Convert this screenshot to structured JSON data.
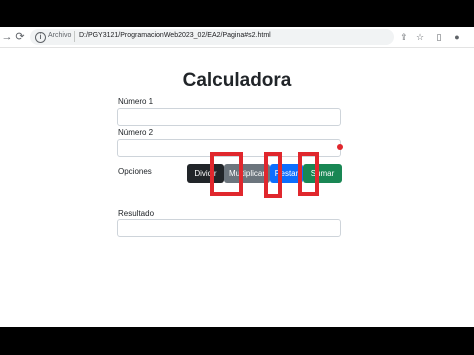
{
  "browser": {
    "scheme_label": "Archivo",
    "url": "D:/PGY3121/ProgramacionWeb2023_02/EA2/Pagina#s2.html",
    "icons": [
      "back-arrow-icon",
      "reload-icon",
      "info-icon",
      "share-icon",
      "star-icon",
      "sidebar-icon",
      "profile-icon"
    ]
  },
  "page": {
    "title": "Calculadora",
    "fields": {
      "numero1": {
        "label": "Número 1",
        "value": ""
      },
      "numero2": {
        "label": "Número 2",
        "value": ""
      },
      "opciones": {
        "label": "Opciones"
      },
      "resultado": {
        "label": "Resultado",
        "value": ""
      }
    },
    "buttons": {
      "dividir": "Dividir",
      "multiplicar": "Multiplicar",
      "restar": "Restar",
      "sumar": "Sumar"
    }
  },
  "colors": {
    "dividir": "#212529",
    "multiplicar": "#6c757d",
    "restar": "#0d6efd",
    "sumar": "#198754",
    "annotation": "#e0272d"
  }
}
